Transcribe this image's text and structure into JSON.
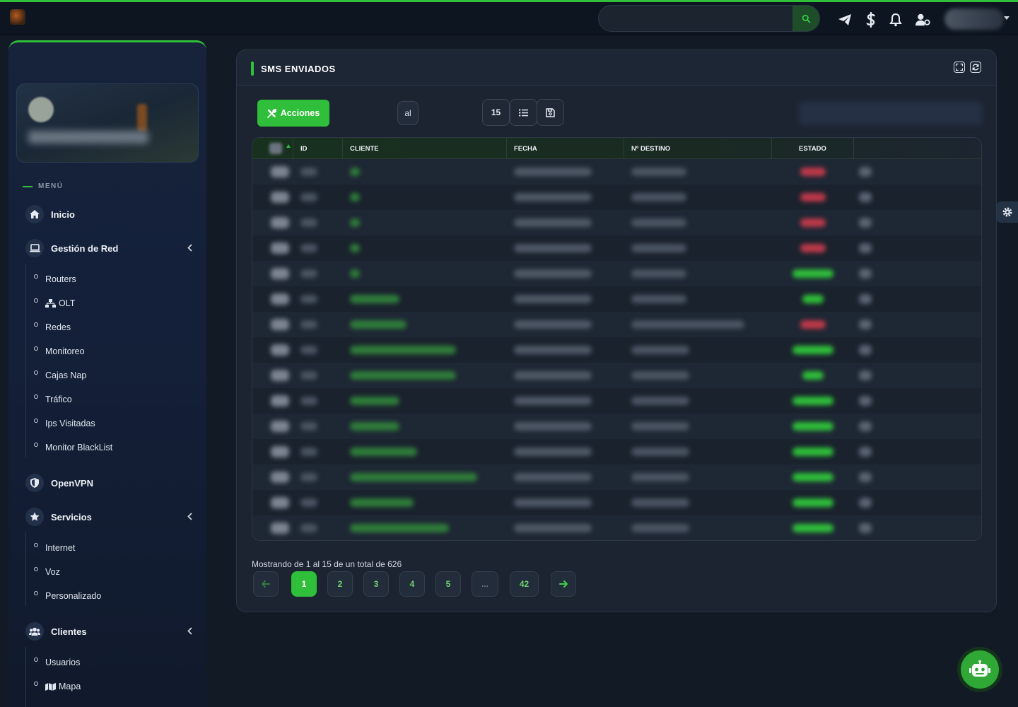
{
  "header": {
    "search_placeholder": "",
    "icons": [
      "search-icon",
      "telegram-icon",
      "dollar-icon",
      "bell-icon",
      "user-cog-icon"
    ]
  },
  "sidebar": {
    "menu_label": "MENÚ",
    "items": {
      "inicio": "Inicio",
      "gestion_red": "Gestión de Red",
      "routers": "Routers",
      "olt": "OLT",
      "redes": "Redes",
      "monitoreo": "Monitoreo",
      "cajas_nap": "Cajas Nap",
      "trafico": "Tráfico",
      "ips_visitadas": "Ips Visitadas",
      "monitor_blacklist": "Monitor BlackList",
      "openvpn": "OpenVPN",
      "servicios": "Servicios",
      "internet": "Internet",
      "voz": "Voz",
      "personalizado": "Personalizado",
      "clientes": "Clientes",
      "usuarios": "Usuarios",
      "mapa": "Mapa"
    }
  },
  "card": {
    "title": "SMS ENVIADOS",
    "acciones_label": "Acciones",
    "date_sep": "al",
    "page_size": "15",
    "columns": [
      "ID",
      "CLIENTE",
      "FECHA",
      "Nº DESTINO",
      "ESTADO"
    ],
    "showing": "Mostrando de 1 al 15 de un total de 626",
    "pages": [
      "1",
      "2",
      "3",
      "4",
      "5",
      "...",
      "42"
    ]
  },
  "colors": {
    "accent": "#2fbf3a",
    "status_error": "#c0394a",
    "status_ok": "#2fbf3a"
  },
  "rows_status": [
    "error",
    "error",
    "error",
    "error",
    "ok",
    "ok",
    "error",
    "ok",
    "ok",
    "ok",
    "ok",
    "ok",
    "ok",
    "ok",
    "ok"
  ]
}
